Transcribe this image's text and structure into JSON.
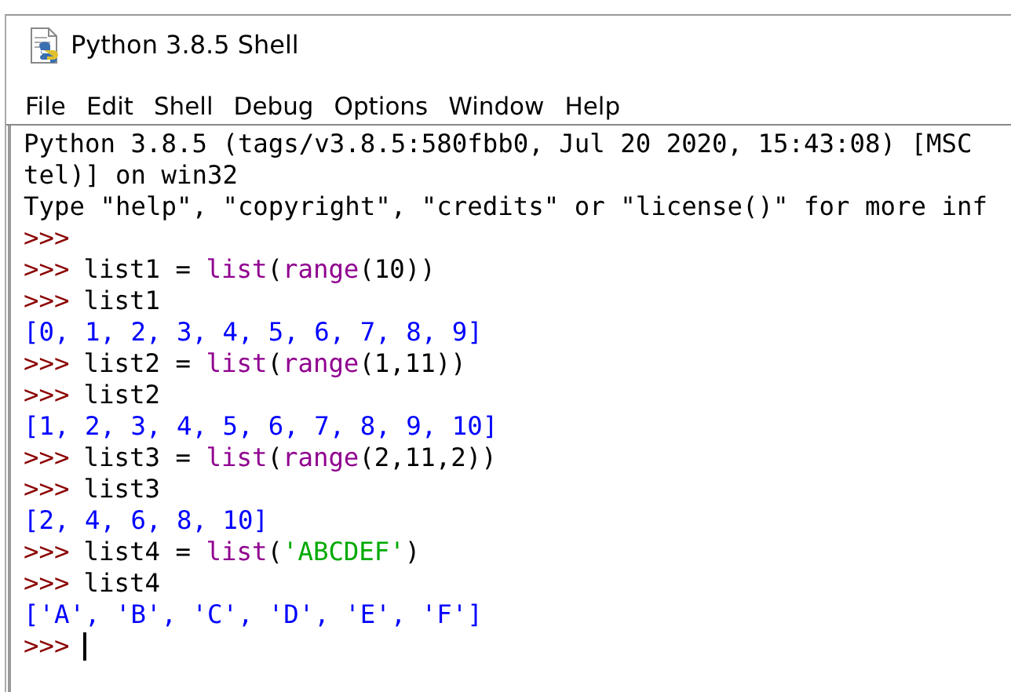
{
  "window": {
    "title": "Python 3.8.5 Shell"
  },
  "menu": [
    "File",
    "Edit",
    "Shell",
    "Debug",
    "Options",
    "Window",
    "Help"
  ],
  "lines": [
    [
      {
        "kind": "stdout",
        "text": "Python 3.8.5 (tags/v3.8.5:580fbb0, Jul 20 2020, 15:43:08) [MSC"
      }
    ],
    [
      {
        "kind": "stdout",
        "text": "tel)] on win32"
      }
    ],
    [
      {
        "kind": "stdout",
        "text": "Type \"help\", \"copyright\", \"credits\" or \"license()\" for more inf"
      }
    ],
    [
      {
        "kind": "prompt",
        "text": ">>>"
      }
    ],
    [
      {
        "kind": "prompt",
        "text": ">>>"
      },
      {
        "kind": "code",
        "text": "list1 = "
      },
      {
        "kind": "builtin",
        "text": "list"
      },
      {
        "kind": "code",
        "text": "("
      },
      {
        "kind": "builtin",
        "text": "range"
      },
      {
        "kind": "code",
        "text": "(10))"
      }
    ],
    [
      {
        "kind": "prompt",
        "text": ">>>"
      },
      {
        "kind": "code",
        "text": "list1"
      }
    ],
    [
      {
        "kind": "output",
        "text": "[0, 1, 2, 3, 4, 5, 6, 7, 8, 9]"
      }
    ],
    [
      {
        "kind": "prompt",
        "text": ">>>"
      },
      {
        "kind": "code",
        "text": "list2 = "
      },
      {
        "kind": "builtin",
        "text": "list"
      },
      {
        "kind": "code",
        "text": "("
      },
      {
        "kind": "builtin",
        "text": "range"
      },
      {
        "kind": "code",
        "text": "(1,11))"
      }
    ],
    [
      {
        "kind": "prompt",
        "text": ">>>"
      },
      {
        "kind": "code",
        "text": "list2"
      }
    ],
    [
      {
        "kind": "output",
        "text": "[1, 2, 3, 4, 5, 6, 7, 8, 9, 10]"
      }
    ],
    [
      {
        "kind": "prompt",
        "text": ">>>"
      },
      {
        "kind": "code",
        "text": "list3 = "
      },
      {
        "kind": "builtin",
        "text": "list"
      },
      {
        "kind": "code",
        "text": "("
      },
      {
        "kind": "builtin",
        "text": "range"
      },
      {
        "kind": "code",
        "text": "(2,11,2))"
      }
    ],
    [
      {
        "kind": "prompt",
        "text": ">>>"
      },
      {
        "kind": "code",
        "text": "list3"
      }
    ],
    [
      {
        "kind": "output",
        "text": "[2, 4, 6, 8, 10]"
      }
    ],
    [
      {
        "kind": "prompt",
        "text": ">>>"
      },
      {
        "kind": "code",
        "text": "list4 = "
      },
      {
        "kind": "builtin",
        "text": "list"
      },
      {
        "kind": "code",
        "text": "("
      },
      {
        "kind": "string",
        "text": "'ABCDEF'"
      },
      {
        "kind": "code",
        "text": ")"
      }
    ],
    [
      {
        "kind": "prompt",
        "text": ">>>"
      },
      {
        "kind": "code",
        "text": "list4"
      }
    ],
    [
      {
        "kind": "output",
        "text": "['A', 'B', 'C', 'D', 'E', 'F']"
      }
    ],
    [
      {
        "kind": "prompt",
        "text": ">>>"
      },
      {
        "kind": "cursor"
      }
    ]
  ]
}
